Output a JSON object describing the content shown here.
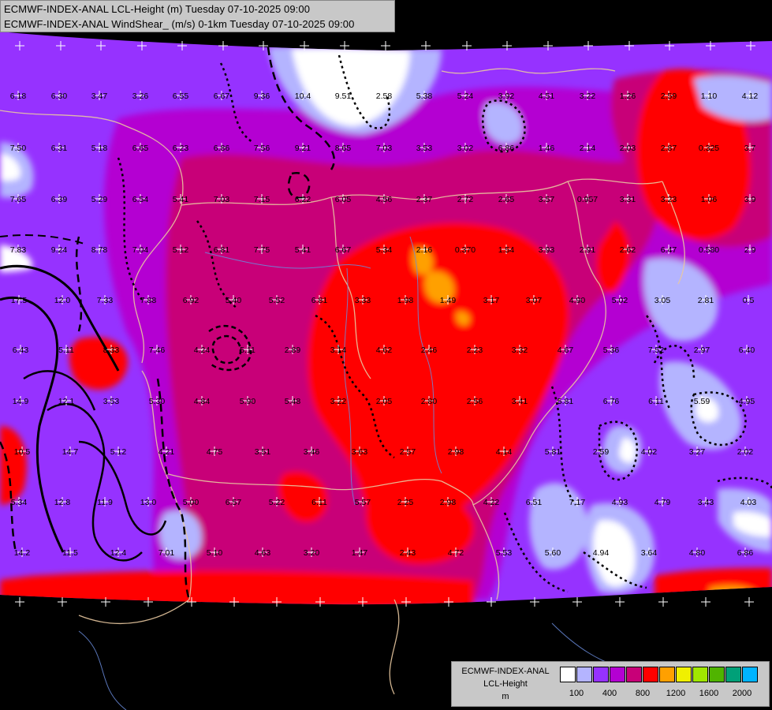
{
  "titles": {
    "line1": "ECMWF-INDEX-ANAL LCL-Height (m) Tuesday 07-10-2025 09:00",
    "line2": "ECMWF-INDEX-ANAL WindShear_ (m/s) 0-1km Tuesday 07-10-2025 09:00"
  },
  "legend": {
    "name_line1": "ECMWF-INDEX-ANAL",
    "name_line2": "LCL-Height",
    "name_line3": "m",
    "colors": [
      "#ffffff",
      "#b4b4ff",
      "#9632ff",
      "#b400d2",
      "#c80078",
      "#ff0000",
      "#ffa000",
      "#f0f000",
      "#a0e600",
      "#50b400",
      "#00a078",
      "#00b4ff"
    ],
    "ticks": [
      "100",
      "400",
      "800",
      "1200",
      "1600",
      "2000"
    ]
  },
  "palette": {
    "background": "#000000",
    "white": "#ffffff",
    "lavender": "#b4b4ff",
    "violet": "#9632ff",
    "purple": "#b400d2",
    "magenta": "#c80078",
    "red": "#ff0000",
    "orange": "#ffa000",
    "yellow": "#f0f000",
    "border": "#e8c8a0",
    "river": "#6a8cdc"
  },
  "map_labels": [
    "6.18",
    "6.30",
    "3.47",
    "3.26",
    "6.55",
    "6.67",
    "9.36",
    "10.4",
    "9.51",
    "2.58",
    "5.38",
    "5.24",
    "3.92",
    "4.51",
    "3.22",
    "1.26",
    "2.59",
    "1.10",
    "4.12",
    "7.50",
    "6.31",
    "5.18",
    "6.65",
    "6.23",
    "6.86",
    "7.56",
    "9.21",
    "8.65",
    "7.03",
    "3.53",
    "3.02",
    "6.86",
    "1.46",
    "2.14",
    "2.03",
    "2.87",
    "0.325",
    "3.7",
    "7.65",
    "6.39",
    "5.29",
    "6.54",
    "5.41",
    "7.03",
    "7.15",
    "6.22",
    "6.05",
    "4.56",
    "2.37",
    "2.72",
    "2.65",
    "3.57",
    "0.957",
    "3.31",
    "3.23",
    "1.06",
    "3.9",
    "7.83",
    "9.24",
    "8.78",
    "7.04",
    "5.12",
    "6.81",
    "7.75",
    "5.41",
    "6.67",
    "5.34",
    "2.16",
    "0.370",
    "1.54",
    "3.93",
    "2.91",
    "2.62",
    "6.47",
    "0.580",
    "2.9",
    "17.5",
    "12.0",
    "7.33",
    "7.88",
    "6.92",
    "5.40",
    "5.52",
    "6.81",
    "3.33",
    "1.98",
    "1.49",
    "3.17",
    "3.07",
    "4.90",
    "5.02",
    "3.05",
    "2.81",
    "0.5",
    "6.43",
    "5.11",
    "8.33",
    "7.46",
    "4.24",
    "5.11",
    "2.89",
    "3.14",
    "4.62",
    "2.46",
    "2.23",
    "3.32",
    "4.67",
    "5.36",
    "7.52",
    "2.97",
    "6.40",
    "14.9",
    "12.1",
    "3.53",
    "5.30",
    "4.84",
    "5.90",
    "5.48",
    "3.22",
    "2.05",
    "2.80",
    "2.56",
    "3.41",
    "5.81",
    "6.76",
    "6.11",
    "5.59",
    "4.95",
    "10.5",
    "14.7",
    "5.12",
    "4.21",
    "4.75",
    "3.51",
    "3.46",
    "3.63",
    "2.57",
    "2.98",
    "4.14",
    "5.81",
    "2.59",
    "4.02",
    "3.27",
    "2.02",
    "5.34",
    "12.8",
    "11.9",
    "13.0",
    "5.00",
    "6.57",
    "5.22",
    "6.11",
    "5.57",
    "2.25",
    "2.98",
    "4.22",
    "6.51",
    "7.17",
    "4.93",
    "4.79",
    "3.43",
    "4.03",
    "14.2",
    "11.5",
    "12.4",
    "7.01",
    "5.10",
    "4.63",
    "3.20",
    "1.47",
    "2.43",
    "4.72",
    "5.53",
    "5.60",
    "4.94",
    "3.64",
    "4.80",
    "6.86"
  ]
}
